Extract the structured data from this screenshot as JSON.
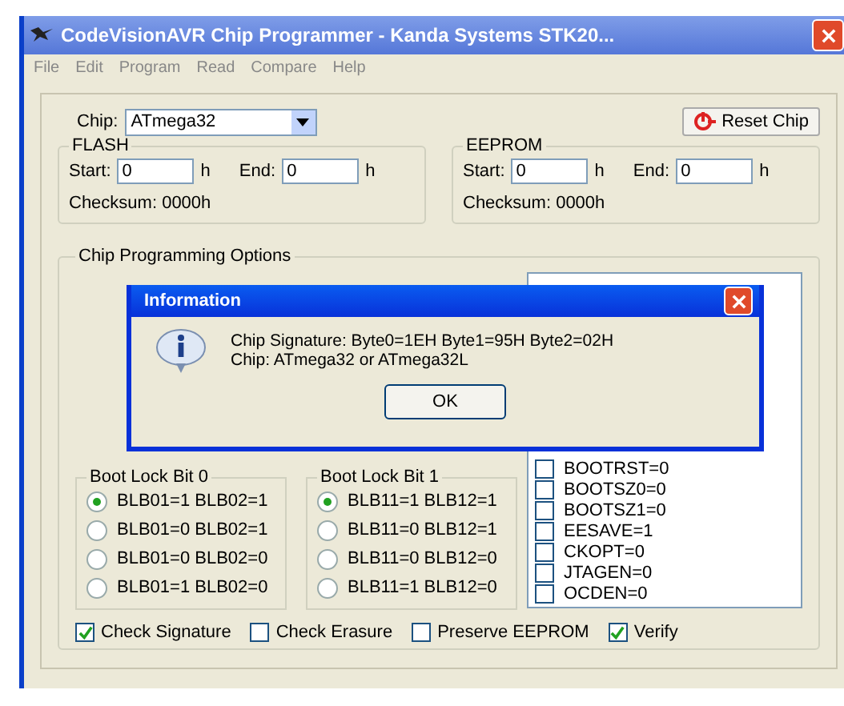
{
  "window": {
    "title": "CodeVisionAVR Chip Programmer - Kanda Systems STK20..."
  },
  "menu": [
    "File",
    "Edit",
    "Program",
    "Read",
    "Compare",
    "Help"
  ],
  "chip": {
    "label": "Chip:",
    "value": "ATmega32"
  },
  "reset_button": "Reset Chip",
  "memories": [
    {
      "title": "FLASH",
      "start_label": "Start:",
      "start": "0",
      "start_unit": "h",
      "end_label": "End:",
      "end": "0",
      "end_unit": "h",
      "checksum": "Checksum: 0000h"
    },
    {
      "title": "EEPROM",
      "start_label": "Start:",
      "start": "0",
      "start_unit": "h",
      "end_label": "End:",
      "end": "0",
      "end_unit": "h",
      "checksum": "Checksum: 0000h"
    }
  ],
  "options": {
    "title": "Chip Programming Options",
    "lock_groups": [
      {
        "title": "Boot Lock Bit 0",
        "items": [
          {
            "label": "BLB01=1 BLB02=1",
            "selected": true
          },
          {
            "label": "BLB01=0 BLB02=1",
            "selected": false
          },
          {
            "label": "BLB01=0 BLB02=0",
            "selected": false
          },
          {
            "label": "BLB01=1 BLB02=0",
            "selected": false
          }
        ]
      },
      {
        "title": "Boot Lock Bit 1",
        "items": [
          {
            "label": "BLB11=1 BLB12=1",
            "selected": true
          },
          {
            "label": "BLB11=0 BLB12=1",
            "selected": false
          },
          {
            "label": "BLB11=0 BLB12=0",
            "selected": false
          },
          {
            "label": "BLB11=1 BLB12=0",
            "selected": false
          }
        ]
      }
    ],
    "fuses": [
      {
        "label": "BOOTRST=0",
        "checked": false
      },
      {
        "label": "BOOTSZ0=0",
        "checked": false
      },
      {
        "label": "BOOTSZ1=0",
        "checked": false
      },
      {
        "label": "EESAVE=1",
        "checked": false
      },
      {
        "label": "CKOPT=0",
        "checked": false
      },
      {
        "label": "JTAGEN=0",
        "checked": false
      },
      {
        "label": "OCDEN=0",
        "checked": false
      }
    ],
    "checks": [
      {
        "label": "Check Signature",
        "checked": true
      },
      {
        "label": "Check Erasure",
        "checked": false
      },
      {
        "label": "Preserve EEPROM",
        "checked": false
      },
      {
        "label": "Verify",
        "checked": true
      }
    ]
  },
  "dialog": {
    "title": "Information",
    "lines": [
      "Chip Signature: Byte0=1EH Byte1=95H Byte2=02H",
      "Chip: ATmega32 or ATmega32L"
    ],
    "button": "OK"
  }
}
